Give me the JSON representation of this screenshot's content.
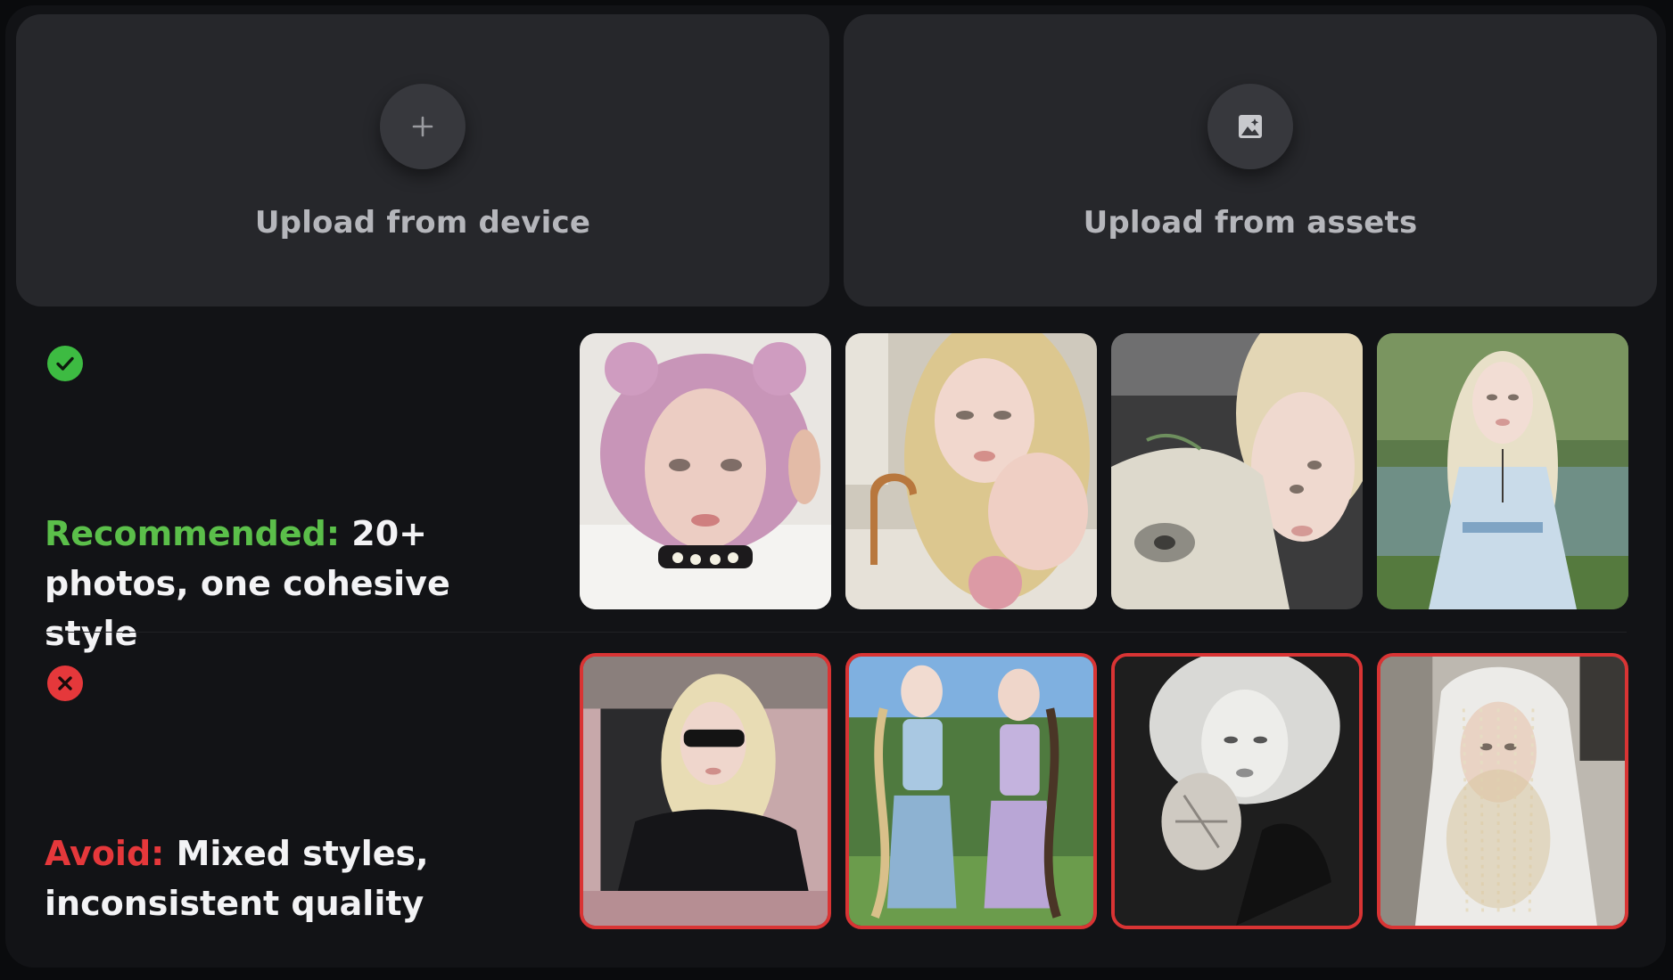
{
  "upload": {
    "device": {
      "label": "Upload from device",
      "icon": "plus-icon"
    },
    "assets": {
      "label": "Upload from assets",
      "icon": "image-sparkle-icon"
    }
  },
  "recommended": {
    "status_icon": "check-circle-icon",
    "status_color": "#3dbb42",
    "accent_text": "Recommended:",
    "body_text": " 20+ photos, one cohesive style",
    "photos": [
      "pink-hair-portrait",
      "blonde-sink-portrait",
      "blonde-car-seat-portrait",
      "blonde-forest-stream-portrait"
    ]
  },
  "avoid": {
    "status_icon": "x-circle-icon",
    "status_color": "#e5383b",
    "accent_text": "Avoid:",
    "body_text": " Mixed styles, inconsistent quality",
    "photos": [
      "blonde-pink-car-sunglasses",
      "two-girls-braids-outdoor",
      "blonde-shell-monochrome",
      "veiled-white-hood-studio"
    ]
  },
  "colors": {
    "recommended_accent": "#5bbf4a",
    "avoid_accent": "#e5383b",
    "avoid_border": "#d93434",
    "card_bg": "#26272b",
    "panel_bg": "#121316"
  }
}
